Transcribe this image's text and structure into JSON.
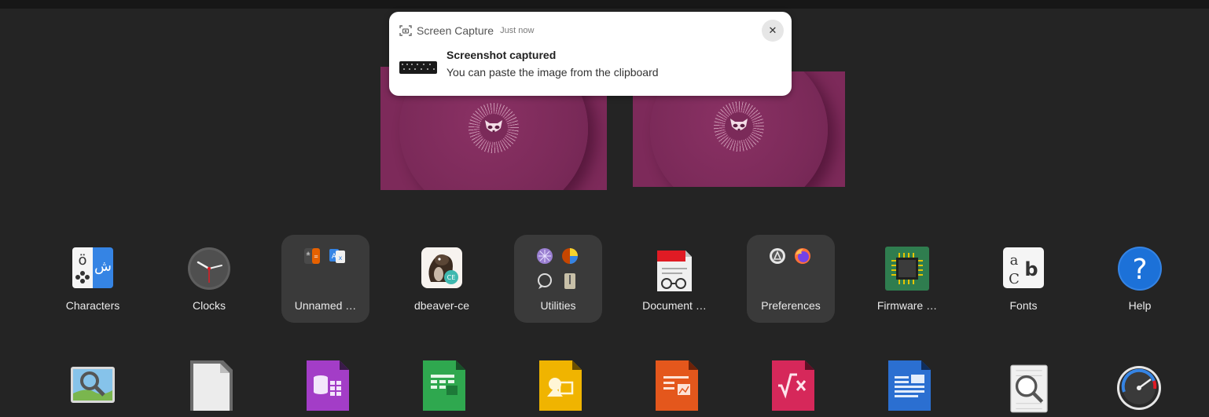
{
  "notification": {
    "app_name": "Screen Capture",
    "time": "Just now",
    "title": "Screenshot captured",
    "body": "You can paste the image from the clipboard",
    "close_glyph": "✕",
    "icons": {
      "app": "screenshot-icon",
      "close": "close-icon"
    }
  },
  "workspaces": [
    {
      "name": "workspace-1"
    },
    {
      "name": "workspace-2"
    }
  ],
  "apps_row1": [
    {
      "label": "Characters",
      "icon": "characters-icon",
      "type": "app"
    },
    {
      "label": "Clocks",
      "icon": "clock-icon",
      "type": "app"
    },
    {
      "label": "Unnamed …",
      "icon": "folder-icon",
      "type": "folder"
    },
    {
      "label": "dbeaver-ce",
      "icon": "dbeaver-icon",
      "type": "app"
    },
    {
      "label": "Utilities",
      "icon": "folder-icon",
      "type": "folder"
    },
    {
      "label": "Document …",
      "icon": "document-viewer-icon",
      "type": "app"
    },
    {
      "label": "Preferences",
      "icon": "folder-icon",
      "type": "folder"
    },
    {
      "label": "Firmware …",
      "icon": "firmware-icon",
      "type": "app"
    },
    {
      "label": "Fonts",
      "icon": "fonts-icon",
      "type": "app"
    },
    {
      "label": "Help",
      "icon": "help-icon",
      "type": "app"
    }
  ],
  "apps_row2_icons": [
    "image-viewer-icon",
    "libreoffice-icon",
    "libreoffice-base-icon",
    "libreoffice-calc-icon",
    "libreoffice-draw-icon",
    "libreoffice-impress-icon",
    "libreoffice-math-icon",
    "libreoffice-writer-icon",
    "search-document-icon",
    "disk-usage-icon"
  ],
  "glyphs": {
    "characters_arabic": "ش",
    "characters_latin": "ö",
    "fonts_a": "a",
    "fonts_b": "b",
    "fonts_c": "C",
    "help": "?",
    "dbeaver_badge": "CE",
    "utilities_translate": "A文"
  }
}
